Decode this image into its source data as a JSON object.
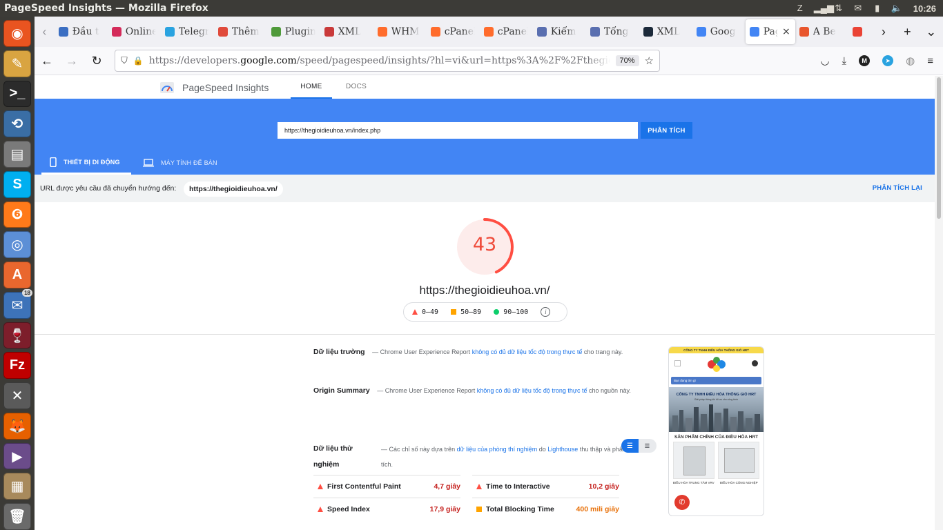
{
  "os": {
    "window_title": "PageSpeed Insights — Mozilla Firefox",
    "clock": "10:26",
    "tray_icons": [
      "zotero-icon",
      "signal-icon",
      "network-icon",
      "mail-icon",
      "battery-icon",
      "volume-icon"
    ]
  },
  "launcher": {
    "items": [
      {
        "name": "ubuntu-dash-icon",
        "color": "#e95420",
        "glyph": "◉"
      },
      {
        "name": "text-editor-icon",
        "color": "#d9a441",
        "glyph": "✎"
      },
      {
        "name": "terminal-icon",
        "color": "#2b2b2b",
        "glyph": ">_"
      },
      {
        "name": "update-manager-icon",
        "color": "#3a6ea5",
        "glyph": "⟲"
      },
      {
        "name": "file-cabinet-icon",
        "color": "#7a7a7a",
        "glyph": "▤"
      },
      {
        "name": "skype-icon",
        "color": "#00aff0",
        "glyph": "S"
      },
      {
        "name": "firefox-flame-icon",
        "color": "#ff7a1a",
        "glyph": "❻"
      },
      {
        "name": "chromium-icon",
        "color": "#5c8fd6",
        "glyph": "◎"
      },
      {
        "name": "software-center-icon",
        "color": "#e9672e",
        "glyph": "A"
      },
      {
        "name": "thunderbird-icon",
        "color": "#3d73b9",
        "glyph": "✉",
        "badge": "18"
      },
      {
        "name": "wine-icon",
        "color": "#7d1e2b",
        "glyph": "🍷"
      },
      {
        "name": "filezilla-icon",
        "color": "#bf0000",
        "glyph": "Fz"
      },
      {
        "name": "system-tools-icon",
        "color": "#5a5a5a",
        "glyph": "✕"
      },
      {
        "name": "firefox-icon",
        "color": "#e66000",
        "glyph": "🦊"
      },
      {
        "name": "video-icon",
        "color": "#6b4c8a",
        "glyph": "▶"
      },
      {
        "name": "archive-icon",
        "color": "#a88a5c",
        "glyph": "▦"
      },
      {
        "name": "trash-icon",
        "color": "#6a6a6a",
        "glyph": "🗑"
      }
    ]
  },
  "browser": {
    "tabs": [
      {
        "label": "Đầu t",
        "fav_color": "#3b6ec2",
        "icon": "book-icon"
      },
      {
        "label": "Online",
        "fav_color": "#d42b5a",
        "icon": "online-icon"
      },
      {
        "label": "Telegr",
        "fav_color": "#2aa3e0",
        "icon": "telegram-icon"
      },
      {
        "label": "Thêm",
        "fav_color": "#e04a3b",
        "icon": "joomla-icon"
      },
      {
        "label": "Plugin",
        "fav_color": "#4f9a3a",
        "icon": "joomla-icon"
      },
      {
        "label": "XML",
        "fav_color": "#c93a3a",
        "icon": "joomla-icon"
      },
      {
        "label": "WHM",
        "fav_color": "#ff6c2c",
        "icon": "cpanel-icon"
      },
      {
        "label": "cPanel",
        "fav_color": "#ff6c2c",
        "icon": "cpanel-icon"
      },
      {
        "label": "cPanel",
        "fav_color": "#ff6c2c",
        "icon": "cpanel-icon"
      },
      {
        "label": "Kiểm",
        "fav_color": "#5a6fb0",
        "icon": "check-icon"
      },
      {
        "label": "Tổng",
        "fav_color": "#5a6fb0",
        "icon": "summary-icon"
      },
      {
        "label": "XML",
        "fav_color": "#1c2a3a",
        "icon": "xml-icon"
      },
      {
        "label": "Goog",
        "fav_color": "#4285f4",
        "icon": "google-dev-icon"
      },
      {
        "label": "Pag",
        "fav_color": "#4285f4",
        "icon": "google-dev-icon",
        "active": true
      },
      {
        "label": "A Be",
        "fav_color": "#e8552d",
        "icon": "blog-icon"
      },
      {
        "label": "",
        "fav_color": "#ea4335",
        "icon": "google-icon"
      }
    ],
    "url_prefix": "https://developers.",
    "url_domain": "google.com",
    "url_suffix": "/speed/pagespeed/insights/?hl=vi&url=https%3A%2F%2Fthegioidieuhoa.vn",
    "zoom": "70%"
  },
  "psi": {
    "brand": "PageSpeed Insights",
    "nav_home": "HOME",
    "nav_docs": "DOCS",
    "input_url": "https://thegioidieuhoa.vn/index.php",
    "analyze": "PHÂN TÍCH",
    "tab_mobile": "THIẾT BỊ DI ĐỘNG",
    "tab_desktop": "MÁY TÍNH ĐỂ BÀN",
    "redirect_label": "URL được yêu cầu đã chuyển hướng đến:",
    "redirect_url": "https://thegioidieuhoa.vn/",
    "reanalyze": "PHÂN TÍCH LẠI",
    "score": 43,
    "score_display": "43",
    "final_url": "https://thegioidieuhoa.vn/",
    "legend": {
      "fail": "0–49",
      "average": "50–89",
      "pass": "90–100"
    },
    "field_data": {
      "title": "Dữ liệu trường",
      "text_before": "— Chrome User Experience Report",
      "link": "không có đủ dữ liệu tốc độ trong thực tế",
      "text_after": "cho trang này."
    },
    "origin_summary": {
      "title": "Origin Summary",
      "text_before": "— Chrome User Experience Report",
      "link": "không có đủ dữ liệu tốc độ trong thực tế",
      "text_after": "cho nguồn này."
    },
    "lab_data": {
      "title": "Dữ liệu thử nghiệm",
      "text_before": "— Các chỉ số này dựa trên",
      "link1": "dữ liệu của phòng thí nghiệm",
      "text_mid": "do",
      "link2": "Lighthouse",
      "text_after": "thu thập và phân tích."
    },
    "metrics": [
      {
        "name": "First Contentful Paint",
        "value": "4,7 giây",
        "status": "fail"
      },
      {
        "name": "Time to Interactive",
        "value": "10,2 giây",
        "status": "fail"
      },
      {
        "name": "Speed Index",
        "value": "17,9 giây",
        "status": "fail"
      },
      {
        "name": "Total Blocking Time",
        "value": "400 mili giây",
        "status": "average"
      }
    ],
    "phone": {
      "top_strip": "CÔNG TY TNHH ĐIỀU HÒA THÔNG GIÓ HRT",
      "search_placeholder": "Bạn đang tìm gì",
      "hero_caption": "CÔNG TY TNHH ĐIỀU HÒA THÔNG GIÓ HRT",
      "hero_sub": "Giải pháp thông khí tối ưu cho công trình",
      "products_title": "SẢN PHẨM CHÍNH CỦA ĐIỀU HÒA HRT",
      "product1": "ĐIỀU HÒA TRUNG TÂM VRV",
      "product2": "ĐIỀU HÒA CÔNG NGHIỆP"
    }
  },
  "colors": {
    "psi_blue": "#4285f4",
    "fail_red": "#ff4e42",
    "average_orange": "#ffa400",
    "pass_green": "#0cce6b"
  }
}
